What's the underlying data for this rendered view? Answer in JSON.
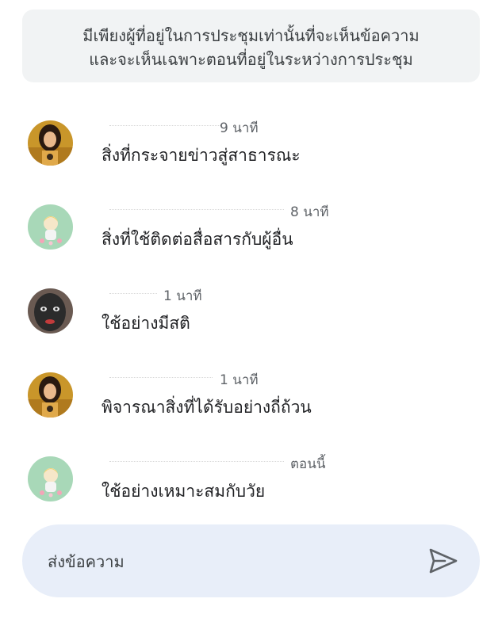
{
  "notice": {
    "line1": "มีเพียงผู้ที่อยู่ในการประชุมเท่านั้นที่จะเห็นข้อความ",
    "line2": "และจะเห็นเฉพาะตอนที่อยู่ในระหว่างการประชุม"
  },
  "messages": [
    {
      "time": "9 นาที",
      "text": "สิ่งที่กระจายข่าวสู่สาธารณะ",
      "avatar": "girl-photo-avatar"
    },
    {
      "time": "8 นาที",
      "text": "สิ่งที่ใช้ติดต่อสื่อสารกับผู้อื่น",
      "avatar": "cartoon-avatar"
    },
    {
      "time": "1 นาที",
      "text": "ใช้อย่างมีสติ",
      "avatar": "face-mask-avatar"
    },
    {
      "time": "1 นาที",
      "text": "พิจารณาสิ่งที่ได้รับอย่างถี่ถ้วน",
      "avatar": "girl-photo-avatar"
    },
    {
      "time": "ตอนนี้",
      "text": "ใช้อย่างเหมาะสมกับวัย",
      "avatar": "cartoon-avatar"
    }
  ],
  "composer": {
    "placeholder": "ส่งข้อความ",
    "send_icon": "send-icon"
  },
  "colors": {
    "notice_bg": "#f1f3f4",
    "composer_bg": "#e8eef9",
    "text": "#202124",
    "muted": "#5f6368"
  }
}
